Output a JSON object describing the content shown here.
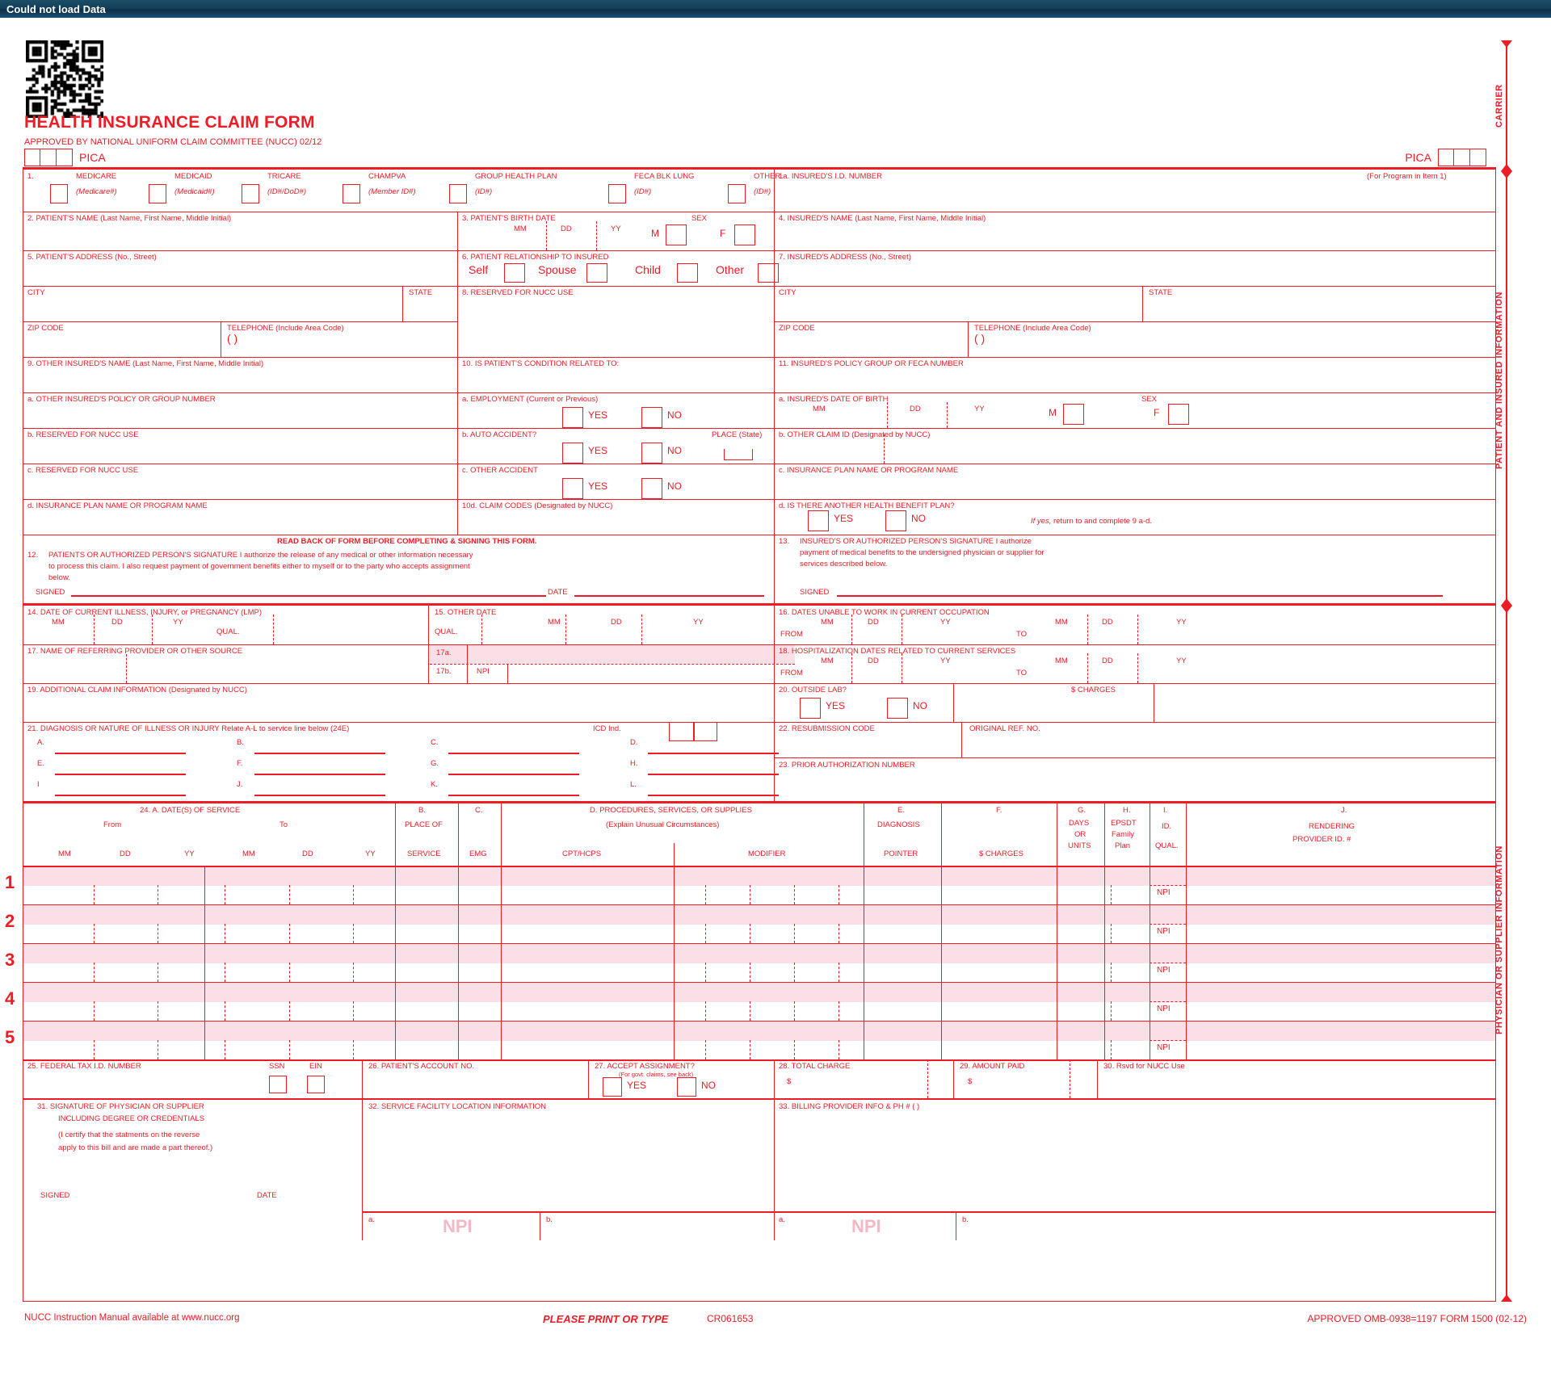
{
  "window": {
    "title": "Could not load Data"
  },
  "header": {
    "form_title": "HEALTH INSURANCE CLAIM FORM",
    "approved_by": "APPROVED BY NATIONAL UNIFORM CLAIM COMMITTEE (NUCC) 02/12",
    "pica_left": "PICA",
    "pica_right": "PICA"
  },
  "sidebar": {
    "carrier": "CARRIER",
    "patient_insured": "PATIENT AND INSURED INFORMATION",
    "physician_supplier": "PHYSICIAN OR SUPPLIER INFORMATION"
  },
  "item1": {
    "number": "1.",
    "types": [
      {
        "label": "MEDICARE",
        "sub": "(Medicare#)"
      },
      {
        "label": "MEDICAID",
        "sub": "(Medicaid#)"
      },
      {
        "label": "TRICARE",
        "sub": "(ID#/DoD#)"
      },
      {
        "label": "CHAMPVA",
        "sub": "(Member ID#)"
      },
      {
        "label": "GROUP HEALTH PLAN",
        "sub": "(ID#)"
      },
      {
        "label": "FECA BLK LUNG",
        "sub": "(ID#)"
      },
      {
        "label": "OTHER",
        "sub": "(ID#)"
      }
    ]
  },
  "item1a": {
    "label": "1a. INSURED'S I.D. NUMBER",
    "note": "(For Program in Item 1)"
  },
  "item2": {
    "label": "2. PATIENT'S NAME (Last Name, First Name, Middle Initial)"
  },
  "item3": {
    "label": "3. PATIENT'S BIRTH DATE",
    "mm": "MM",
    "dd": "DD",
    "yy": "YY",
    "sex": "SEX",
    "m": "M",
    "f": "F"
  },
  "item4": {
    "label": "4. INSURED'S NAME (Last Name, First Name, Middle Initial)"
  },
  "item5": {
    "label": "5. PATIENT'S ADDRESS (No., Street)",
    "city": "CITY",
    "state": "STATE",
    "zip": "ZIP CODE",
    "phone": "TELEPHONE (Include Area Code)",
    "paren": "(          )"
  },
  "item6": {
    "label": "6. PATIENT RELATIONSHIP TO INSURED",
    "options": [
      "Self",
      "Spouse",
      "Child",
      "Other"
    ]
  },
  "item7": {
    "label": "7. INSURED'S ADDRESS (No., Street)",
    "city": "CITY",
    "state": "STATE",
    "zip": "ZIP CODE",
    "phone": "TELEPHONE (Include Area Code)",
    "paren": "(          )"
  },
  "item8": {
    "label": "8. RESERVED FOR NUCC USE"
  },
  "item9": {
    "label": "9. OTHER INSURED'S NAME (Last Name, First Name, Middle Initial)",
    "a": "a. OTHER INSURED'S POLICY OR GROUP NUMBER",
    "b": "b. RESERVED FOR NUCC USE",
    "c": "c. RESERVED FOR NUCC USE",
    "d": "d. INSURANCE PLAN NAME OR PROGRAM NAME"
  },
  "item10": {
    "label": "10. IS PATIENT'S CONDITION RELATED TO:",
    "a": "a. EMPLOYMENT (Current or Previous)",
    "b": "b. AUTO ACCIDENT?",
    "c": "c. OTHER ACCIDENT",
    "d": "10d. CLAIM CODES (Designated by NUCC)",
    "place": "PLACE (State)",
    "yes": "YES",
    "no": "NO"
  },
  "item11": {
    "label": "11. INSURED'S POLICY GROUP OR FECA NUMBER",
    "a": "a. INSURED'S DATE OF BIRTH",
    "mm": "MM",
    "dd": "DD",
    "yy": "YY",
    "sex": "SEX",
    "m": "M",
    "f": "F",
    "b": "b. OTHER CLAIM ID (Designated by NUCC)",
    "c": "c. INSURANCE PLAN NAME OR PROGRAM NAME",
    "d": "d. IS THERE ANOTHER HEALTH BENEFIT PLAN?",
    "yes": "YES",
    "no": "NO",
    "ifyes_italic": "If yes,",
    "ifyes_rest": " return to and complete 9 a-d."
  },
  "readback": "READ BACK OF FORM BEFORE COMPLETING & SIGNING THIS FORM.",
  "item12": {
    "number": "12.",
    "line1": "PATIENTS OR AUTHORIZED PERSON'S SIGNATURE I authorize the release of any medical or other information necessary",
    "line2": "to process this claim. I also request payment of government benefits either to myself or to the party who accepts assignment",
    "line3": "below.",
    "signed": "SIGNED",
    "date": "DATE"
  },
  "item13": {
    "number": "13.",
    "line1": "INSURED'S OR AUTHORIZED PERSON'S SIGNATURE I authorize",
    "line2": "payment of medical benefits to the undersigned physician or supplier for",
    "line3": "services described below.",
    "signed": "SIGNED"
  },
  "item14": {
    "label": "14. DATE OF CURRENT ILLNESS, INJURY, or PREGNANCY (LMP)",
    "mm": "MM",
    "dd": "DD",
    "yy": "YY",
    "qual": "QUAL."
  },
  "item15": {
    "label": "15. OTHER DATE",
    "qual": "QUAL.",
    "mm": "MM",
    "dd": "DD",
    "yy": "YY"
  },
  "item16": {
    "label": "16. DATES UNABLE TO WORK IN CURRENT OCCUPATION",
    "mm": "MM",
    "dd": "DD",
    "yy": "YY",
    "from": "FROM",
    "to": "TO"
  },
  "item17": {
    "label": "17. NAME OF REFERRING PROVIDER OR OTHER SOURCE",
    "a": "17a.",
    "b": "17b.",
    "npi": "NPI"
  },
  "item18": {
    "label": "18. HOSPITALIZATION DATES RELATED TO CURRENT SERVICES",
    "mm": "MM",
    "dd": "DD",
    "yy": "YY",
    "from": "FROM",
    "to": "TO"
  },
  "item19": {
    "label": "19. ADDITIONAL CLAIM INFORMATION (Designated by NUCC)"
  },
  "item20": {
    "label": "20. OUTSIDE LAB?",
    "yes": "YES",
    "no": "NO",
    "charges": "$ CHARGES"
  },
  "item21": {
    "label": "21. DIAGNOSIS OR NATURE OF ILLNESS OR INJURY Relate A-L to service line below (24E)",
    "icd": "ICD Ind.",
    "letters": [
      "A.",
      "B.",
      "C.",
      "D.",
      "E.",
      "F.",
      "G.",
      "H.",
      "I",
      "J.",
      "K.",
      "L."
    ]
  },
  "item22": {
    "label": "22. RESUBMISSION CODE",
    "orig": "ORIGINAL REF. NO."
  },
  "item23": {
    "label": "23. PRIOR AUTHORIZATION NUMBER"
  },
  "item24_header": {
    "a_title": "24. A. DATE(S) OF SERVICE",
    "from": "From",
    "to": "To",
    "mm": "MM",
    "dd": "DD",
    "yy": "YY",
    "b1": "B.",
    "b2": "PLACE OF",
    "b3": "SERVICE",
    "c1": "C.",
    "c2": "EMG",
    "d1": "D. PROCEDURES, SERVICES, OR SUPPLIES",
    "d2": "(Explain Unusual Circumstances)",
    "d3": "CPT/HCPS",
    "d4": "MODIFIER",
    "e1": "E.",
    "e2": "DIAGNOSIS",
    "e3": "POINTER",
    "f1": "F.",
    "f2": "$ CHARGES",
    "g1": "G.",
    "g2": "DAYS",
    "g3": "OR",
    "g4": "UNITS",
    "h1": "H.",
    "h2": "EPSDT",
    "h3": "Family",
    "h4": "Plan",
    "i1": "I.",
    "i2": "ID.",
    "i3": "QUAL.",
    "j1": "J.",
    "j2": "RENDERING",
    "j3": "PROVIDER ID. #"
  },
  "service_rows": [
    {
      "num": "1",
      "npi": "NPI"
    },
    {
      "num": "2",
      "npi": "NPI"
    },
    {
      "num": "3",
      "npi": "NPI"
    },
    {
      "num": "4",
      "npi": "NPI"
    },
    {
      "num": "5",
      "npi": "NPI"
    }
  ],
  "item25": {
    "label": "25. FEDERAL TAX I.D. NUMBER",
    "ssn": "SSN",
    "ein": "EIN"
  },
  "item26": {
    "label": "26. PATIENT'S ACCOUNT NO."
  },
  "item27": {
    "label": "27. ACCEPT ASSIGNMENT?",
    "sub": "(For govt. claims, see back)",
    "yes": "YES",
    "no": "NO"
  },
  "item28": {
    "label": "28. TOTAL CHARGE",
    "dollar": "$"
  },
  "item29": {
    "label": "29. AMOUNT PAID",
    "dollar": "$"
  },
  "item30": {
    "label": "30. Rsvd for NUCC Use"
  },
  "item31": {
    "l1": "31. SIGNATURE OF PHYSICIAN OR SUPPLIER",
    "l2": "INCLUDING DEGREE OR CREDENTIALS",
    "l3": "(I certify that the statments on the reverse",
    "l4": "apply to this bill and are made a part thereof.)",
    "signed": "SIGNED",
    "date": "DATE"
  },
  "item32": {
    "label": "32. SERVICE FACILITY LOCATION INFORMATION",
    "a": "a.",
    "b": "b.",
    "npi": "NPI"
  },
  "item33": {
    "label": "33. BILLING PROVIDER INFO & PH # (          )",
    "a": "a.",
    "b": "b.",
    "npi": "NPI"
  },
  "footer": {
    "left": "NUCC Instruction Manual available at www.nucc.org",
    "center": "PLEASE PRINT OR TYPE",
    "center2": "CR061653",
    "right": "APPROVED OMB-0938=1197 FORM 1500 (02-12)"
  }
}
